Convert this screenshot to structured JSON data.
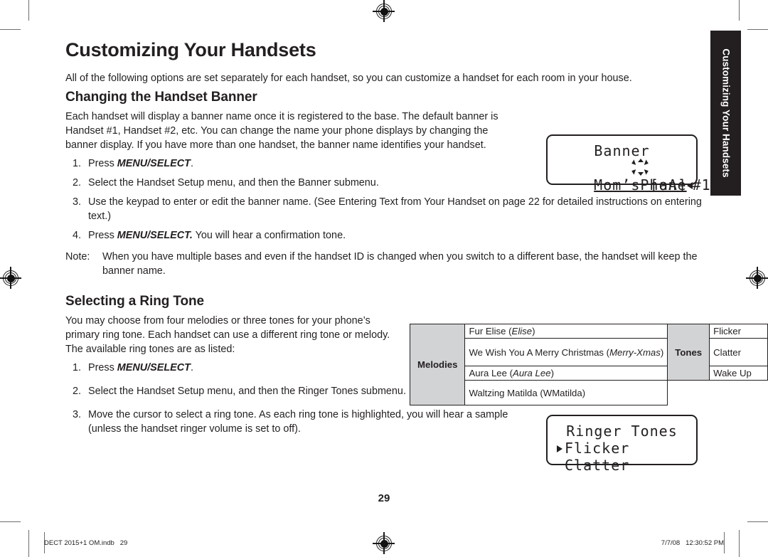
{
  "page": {
    "title": "Customizing Your Handsets",
    "intro": "All of the following options are set separately for each handset, so you can customize a handset for each room in your house.",
    "page_number": "29",
    "side_tab_label": "Customizing Your Handsets"
  },
  "banner_section": {
    "heading": "Changing the Handset Banner",
    "paragraph": "Each handset will display a banner name once it is registered to the base. The default banner is Handset #1, Handset #2, etc. You can change the name your phone displays by changing the banner display. If you have more than one handset, the banner name identifies your handset.",
    "steps": [
      {
        "num": "1.",
        "pre": "Press ",
        "bold": "MENU/SELECT",
        "post": "."
      },
      {
        "num": "2.",
        "pre": "Select the Handset Setup menu, and then the Banner submenu.",
        "bold": "",
        "post": ""
      },
      {
        "num": "3.",
        "pre": "Use the keypad to enter or edit the banner name. (See Entering Text from Your Handset on page 22 for detailed instructions on entering text.)",
        "bold": "",
        "post": ""
      },
      {
        "num": "4.",
        "pre": "Press ",
        "bold": "MENU/SELECT.",
        "post": " You will hear a confirmation tone."
      }
    ],
    "note_label": "Note:",
    "note_text": "When you have multiple bases and even if the handset ID is changed when you switch to a different base, the handset will keep the banner name."
  },
  "ringtone_section": {
    "heading": "Selecting a Ring Tone",
    "paragraph": "You may choose from four melodies or three tones for your phone’s primary ring tone. Each handset can use a different ring tone or melody. The available ring tones are as listed:",
    "steps": [
      {
        "num": "1.",
        "pre": "Press ",
        "bold": "MENU/SELECT",
        "post": "."
      },
      {
        "num": "2.",
        "pre": "Select the Handset Setup menu, and then the Ringer Tones submenu.",
        "bold": "",
        "post": ""
      },
      {
        "num": "3.",
        "pre": "Move the cursor to select a ring tone. As each ring tone is highlighted, you will hear a sample (unless the handset ringer volume is set to off).",
        "bold": "",
        "post": ""
      }
    ]
  },
  "tones_table": {
    "melodies_header": "Melodies",
    "tones_header": "Tones",
    "melodies": [
      {
        "name": "Fur Elise (",
        "display": "Elise",
        "tail": ")"
      },
      {
        "name": "We Wish You A Merry Christmas (",
        "display": "Merry-Xmas",
        "tail": ")"
      },
      {
        "name": "Aura Lee (",
        "display": "Aura Lee",
        "tail": ")"
      },
      {
        "name": "Waltzing Matilda (WMatilda)",
        "display": "",
        "tail": ""
      }
    ],
    "tones": [
      "Flicker",
      "Clatter",
      "Wake Up"
    ]
  },
  "lcd_banner": {
    "line1": "Banner",
    "line2_text": "Mom’sPhone",
    "line2_suffix": "#1",
    "line3": "[aA]"
  },
  "lcd_ringer": {
    "line1": "Ringer Tones",
    "line2": "Flicker",
    "line3": "Clatter"
  },
  "footer": {
    "left": "DECT 2015+1 OM.indb   29",
    "right": "7/7/08   12:30:52 PM"
  },
  "colors": {
    "text": "#231f20",
    "table_header_bg": "#d2d3d5",
    "tab_bg": "#231f20",
    "mark": "#6d6e71"
  }
}
